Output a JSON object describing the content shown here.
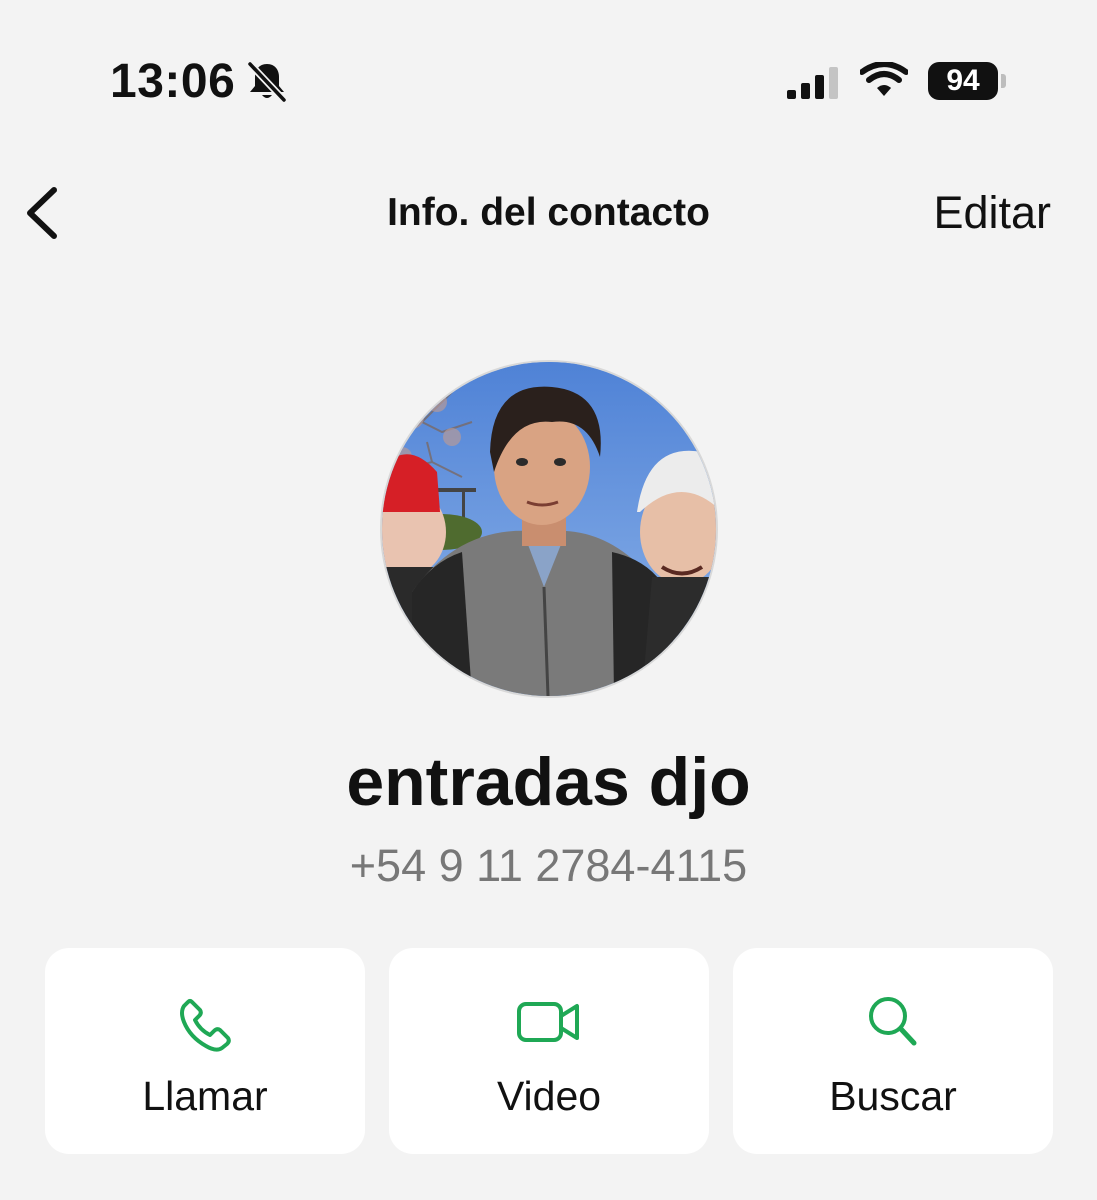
{
  "status_bar": {
    "time": "13:06",
    "battery": "94",
    "icons": [
      "bell-slash-icon",
      "signal-icon",
      "wifi-icon",
      "battery-icon"
    ]
  },
  "nav": {
    "back_icon": "chevron-left-icon",
    "title": "Info. del contacto",
    "edit_label": "Editar"
  },
  "contact": {
    "name": "entradas djo",
    "phone": "+54 9 11 2784-4115"
  },
  "actions": [
    {
      "label": "Llamar",
      "icon": "phone-icon"
    },
    {
      "label": "Video",
      "icon": "video-camera-icon"
    },
    {
      "label": "Buscar",
      "icon": "search-icon"
    }
  ],
  "colors": {
    "background": "#f3f3f3",
    "card": "#ffffff",
    "accent_green": "#1fa855",
    "text_primary": "#111111",
    "text_secondary": "#777777"
  }
}
